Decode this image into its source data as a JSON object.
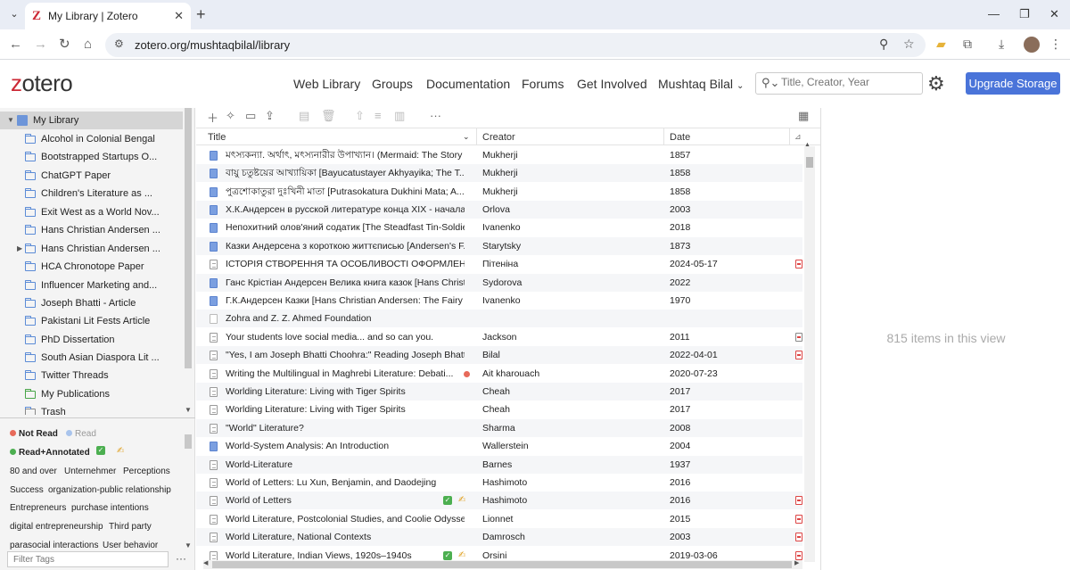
{
  "browser": {
    "tab_title": "My Library | Zotero",
    "tab_favicon": "Z",
    "url": "zotero.org/mushtaqbilal/library"
  },
  "header": {
    "logo": "zotero",
    "nav": [
      "Web Library",
      "Groups",
      "Documentation",
      "Forums",
      "Get Involved"
    ],
    "user": "Mushtaq Bilal",
    "search_placeholder": "Title, Creator, Year",
    "upgrade_label": "Upgrade Storage"
  },
  "collections": [
    {
      "label": "My Library",
      "type": "library"
    },
    {
      "label": "Alcohol in Colonial Bengal",
      "type": "folder"
    },
    {
      "label": "Bootstrapped Startups O...",
      "type": "folder"
    },
    {
      "label": "ChatGPT Paper",
      "type": "folder"
    },
    {
      "label": "Children's Literature as ...",
      "type": "folder"
    },
    {
      "label": "Exit West as a World Nov...",
      "type": "folder"
    },
    {
      "label": "Hans Christian Andersen ...",
      "type": "folder"
    },
    {
      "label": "Hans Christian Andersen ...",
      "type": "folder",
      "has_children": true
    },
    {
      "label": "HCA Chronotope Paper",
      "type": "folder"
    },
    {
      "label": "Influencer Marketing and...",
      "type": "folder"
    },
    {
      "label": "Joseph Bhatti - Article",
      "type": "folder"
    },
    {
      "label": "Pakistani Lit Fests Article",
      "type": "folder"
    },
    {
      "label": "PhD Dissertation",
      "type": "folder"
    },
    {
      "label": "South Asian Diaspora Lit ...",
      "type": "folder"
    },
    {
      "label": "Twitter Threads",
      "type": "folder"
    },
    {
      "label": "My Publications",
      "type": "publications"
    },
    {
      "label": "Trash",
      "type": "trash"
    }
  ],
  "tags": {
    "not_read": "Not Read",
    "read": "Read",
    "read_annotated": "Read+Annotated",
    "words": [
      "80 and over",
      "Unternehmer",
      "Perceptions",
      "Success",
      "organization-public relationship",
      "Entrepreneurs",
      "purchase intentions",
      "digital entrepreneurship",
      "Third party",
      "parasocial interactions",
      "User behavior"
    ],
    "filter_placeholder": "Filter Tags",
    "colors": {
      "not_read": "#e76a5a",
      "read": "#a9c4ec",
      "read_annotated": "#4caf50"
    }
  },
  "columns": {
    "title": "Title",
    "creator": "Creator",
    "date": "Date"
  },
  "items": [
    {
      "icon": "book",
      "title": "মৎস্যকন্যা. অর্থাৎ, মৎস্যনারীর উপাখ্যান। (Mermaid: The Story ...",
      "creator": "Mukherji",
      "date": "1857"
    },
    {
      "icon": "book",
      "title": "বায়ু চতুষ্টয়ের আখ্যায়িকা [Bayucatustayer Akhyayika; The T...",
      "creator": "Mukherji",
      "date": "1858"
    },
    {
      "icon": "book",
      "title": "পুত্রশোকাতুরা দুঃখিনী মাতা [Putrasokatura Dukhini Mata; A...",
      "creator": "Mukherji",
      "date": "1858"
    },
    {
      "icon": "book",
      "title": "Х.К.Андерсен в русской литературе конца XIX - начала...",
      "creator": "Orlova",
      "date": "2003"
    },
    {
      "icon": "book",
      "title": "Непохитний олов'яний содатик [The Steadfast Tin-Soldier]",
      "creator": "Ivanenko",
      "date": "2018"
    },
    {
      "icon": "book",
      "title": "Казки Андерсена з короткою життєписью [Andersen's F...",
      "creator": "Starytsky",
      "date": "1873"
    },
    {
      "icon": "doc",
      "title": "ІСТОРІЯ СТВОРЕННЯ ТА ОСОБЛИВОСТІ ОФОРМЛЕННЯ...",
      "creator": "Пітеніна",
      "date": "2024-05-17",
      "att": true
    },
    {
      "icon": "book",
      "title": "Ганс Крістіан Андерсен Велика книга казок [Hans Christ...",
      "creator": "Sydorova",
      "date": "2022"
    },
    {
      "icon": "book",
      "title": "Г.К.Андерсен Казки [Hans Christian Andersen: The Fairy T...",
      "creator": "Ivanenko",
      "date": "1970"
    },
    {
      "icon": "blank",
      "title": "Zohra and Z. Z. Ahmed Foundation",
      "creator": "",
      "date": ""
    },
    {
      "icon": "doc",
      "title": "Your students love social media... and so can you.",
      "creator": "Jackson",
      "date": "2011",
      "att": true
    },
    {
      "icon": "doc",
      "title": "\"Yes, I am Joseph Bhatti Choohra:\" Reading Joseph Bhatti ...",
      "creator": "Bilal",
      "date": "2022-04-01",
      "att": true
    },
    {
      "icon": "doc",
      "title": "Writing the Multilingual in Maghrebi Literature: Debati...",
      "creator": "Ait kharouach",
      "date": "2020-07-23",
      "reddot": true
    },
    {
      "icon": "doc",
      "title": "Worlding Literature: Living with Tiger Spirits",
      "creator": "Cheah",
      "date": "2017"
    },
    {
      "icon": "doc",
      "title": "Worlding Literature: Living with Tiger Spirits",
      "creator": "Cheah",
      "date": "2017"
    },
    {
      "icon": "doc",
      "title": "\"World\" Literature?",
      "creator": "Sharma",
      "date": "2008"
    },
    {
      "icon": "book",
      "title": "World-System Analysis: An Introduction",
      "creator": "Wallerstein",
      "date": "2004"
    },
    {
      "icon": "doc",
      "title": "World-Literature",
      "creator": "Barnes",
      "date": "1937"
    },
    {
      "icon": "doc",
      "title": "World of Letters: Lu Xun, Benjamin, and Daodejing",
      "creator": "Hashimoto",
      "date": "2016"
    },
    {
      "icon": "doc",
      "title": "World of Letters",
      "creator": "Hashimoto",
      "date": "2016",
      "check": true,
      "att": true
    },
    {
      "icon": "doc",
      "title": "World Literature, Postcolonial Studies, and Coolie Odysse...",
      "creator": "Lionnet",
      "date": "2015",
      "att": true
    },
    {
      "icon": "doc",
      "title": "World Literature, National Contexts",
      "creator": "Damrosch",
      "date": "2003",
      "att": true
    },
    {
      "icon": "doc",
      "title": "World Literature, Indian Views, 1920s–1940s",
      "creator": "Orsini",
      "date": "2019-03-06",
      "check": true,
      "att": true
    }
  ],
  "item_count": "815 items in this view"
}
